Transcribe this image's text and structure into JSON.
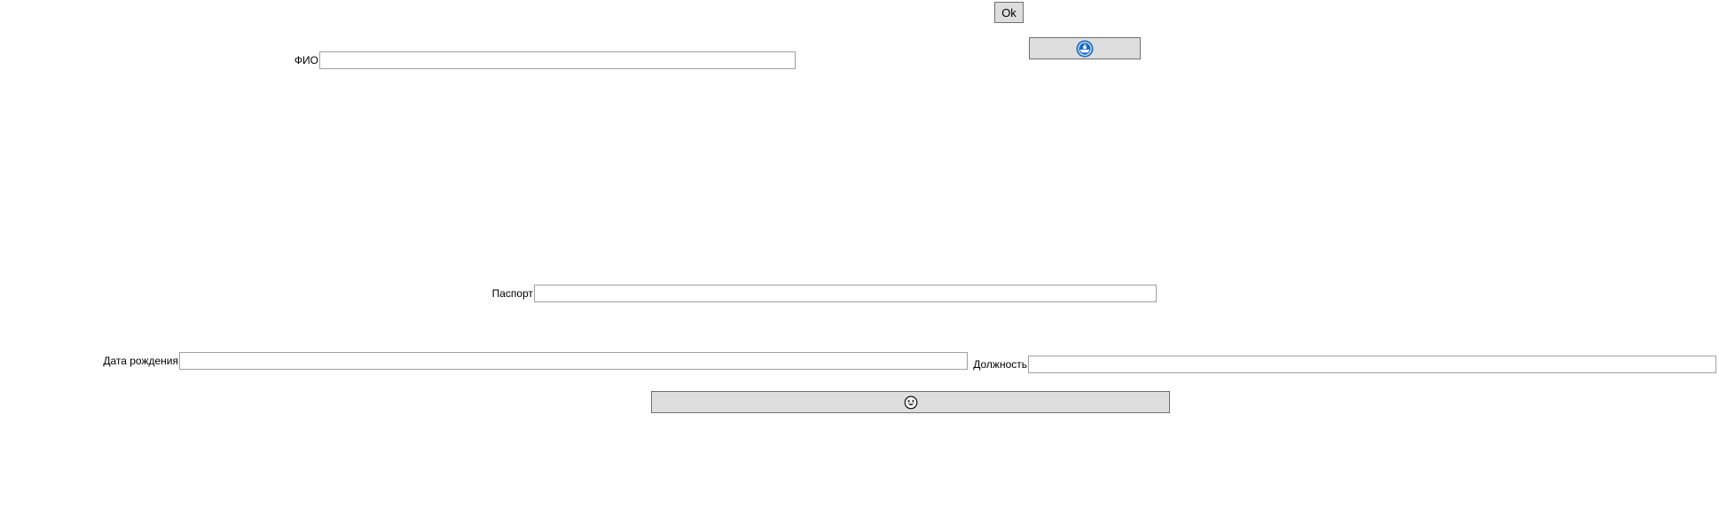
{
  "buttons": {
    "ok_label": "Ok",
    "top_icon": "ship-badge-icon",
    "bottom_icon": "smiley-face-icon"
  },
  "fields": {
    "fio": {
      "label": "ФИО",
      "value": ""
    },
    "passport": {
      "label": "Паспорт",
      "value": ""
    },
    "birth_date": {
      "label": "Дата рождения",
      "value": ""
    },
    "position": {
      "label": "Должность",
      "value": ""
    }
  },
  "colors": {
    "button_bg": "#dddddd",
    "button_border": "#6f6f6f",
    "field_border": "#a0a0a0",
    "icon_blue": "#1b6ec2"
  }
}
